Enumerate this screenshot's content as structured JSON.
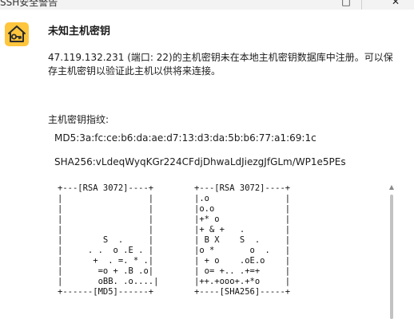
{
  "window": {
    "title": "SSH安全警告",
    "maximize_glyph": "□",
    "close_glyph": "✕"
  },
  "alert": {
    "icon": "key-house-icon",
    "accent_color": "#ffc53d",
    "heading": "未知主机密钥",
    "description": "47.119.132.231 (端口: 22)的主机密钥未在本地主机密钥数据库中注册。可以保存主机密钥以验证此主机以供将来连接。"
  },
  "fingerprints": {
    "label": "主机密钥指纹:",
    "md5": "MD5:3a:fc:ce:b6:da:ae:d7:13:d3:da:5b:b6:77:a1:69:1c",
    "sha256": "SHA256:vLdeqWyqKGr224CFdjDhwaLdJiezgJfGLm/WP1e5PEs"
  },
  "randomart": {
    "md5": "+---[RSA 3072]----+\n|                 |\n|                 |\n|                 |\n|                 |\n|        S  .     |\n|     . .  o .E . |\n|      +  . =. * .|\n|       =o + .B .o|\n|       oBB. .o....|\n+------[MD5]------+",
    "sha256": "+---[RSA 3072]----+\n|.o               |\n|o.o              |\n|+* o             |\n|+ & +   .        |\n| B X    S  .     |\n|o *       o  .   |\n| + o    .oE.o    |\n| o= +.. .+=+     |\n|++.+ooo+.+*o     |\n+----[SHA256]-----+"
  },
  "scrollbar": {
    "up_arrow_glyph": "▲"
  }
}
